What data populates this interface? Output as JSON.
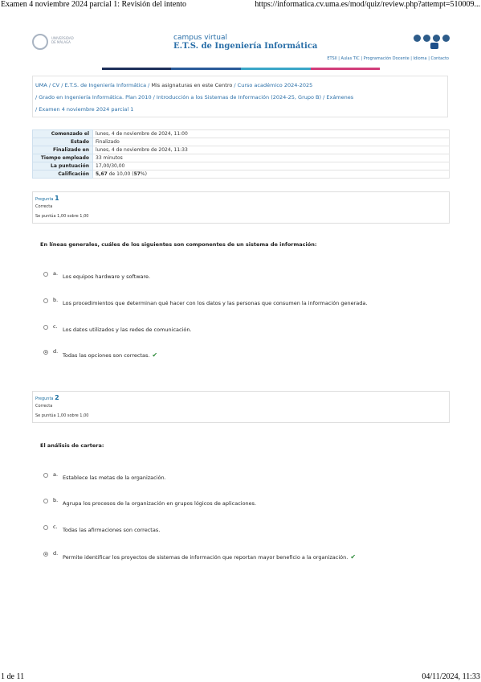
{
  "print_header": {
    "left": "Examen 4 noviembre 2024 parcial 1: Revisión del intento",
    "right": "https://informatica.cv.uma.es/mod/quiz/review.php?attempt=510009..."
  },
  "print_footer": {
    "left": "1 de 11",
    "right": "04/11/2024, 11:33"
  },
  "site": {
    "logo_text_1": "UNIVERSIDAD",
    "logo_text_2": "DE MÁLAGA",
    "cv_label": "campus virtual",
    "title": "E.T.S. de Ingeniería Informática",
    "top_links": "ETSII | Aulas TIC | Programación Docente | Idioma | Contacto",
    "colors": [
      "#ffffff",
      "#1d2f5a",
      "#2a5b9a",
      "#3aa6c8",
      "#d23d7a",
      "#ffffff"
    ]
  },
  "breadcrumb": {
    "items": [
      "UMA",
      "CV",
      "E.T.S. de Ingeniería Informática",
      "Mis asignaturas en este Centro",
      "Curso académico 2024-2025",
      "Grado en Ingeniería Informática. Plan 2010",
      "Introducción a los Sistemas de Información (2024-25, Grupo B)",
      "Exámenes",
      "Examen 4 noviembre 2024 parcial 1"
    ]
  },
  "summary": [
    {
      "label": "Comenzado el",
      "value": "lunes, 4 de noviembre de 2024, 11:00"
    },
    {
      "label": "Estado",
      "value": "Finalizado"
    },
    {
      "label": "Finalizado en",
      "value": "lunes, 4 de noviembre de 2024, 11:33"
    },
    {
      "label": "Tiempo empleado",
      "value": "33 minutos"
    },
    {
      "label": "La puntuación",
      "value": "17,00/30,00"
    },
    {
      "label": "Calificación",
      "value_bold_1": "5,67",
      "value_mid": " de 10,00 (",
      "value_bold_2": "57",
      "value_end": "%)"
    }
  ],
  "questions": [
    {
      "prefix": "Pregunta",
      "number": "1",
      "state": "Correcta",
      "grade": "Se puntúa 1,00 sobre 1,00",
      "text": "En líneas generales, cuáles de los siguientes son componentes de un sistema de información:",
      "options": [
        {
          "letter": "a.",
          "text": "Los equipos hardware y software."
        },
        {
          "letter": "b.",
          "text": "Los procedimientos que determinan qué hacer con los datos y las personas que consumen la información generada."
        },
        {
          "letter": "c.",
          "text": "Los datos utilizados y las redes de comunicación."
        },
        {
          "letter": "d.",
          "text": "Todas las opciones son correctas."
        }
      ]
    },
    {
      "prefix": "Pregunta",
      "number": "2",
      "state": "Correcta",
      "grade": "Se puntúa 1,00 sobre 1,00",
      "text": "El análisis de cartera:",
      "options": [
        {
          "letter": "a.",
          "text": "Establece las metas de la organización."
        },
        {
          "letter": "b.",
          "text": "Agrupa los procesos de la organización en grupos lógicos de aplicaciones."
        },
        {
          "letter": "c.",
          "text": "Todas las afirmaciones son correctas."
        },
        {
          "letter": "d.",
          "text": "Permite identificar los proyectos de sistemas de información que reportan mayor beneficio a la organización."
        }
      ]
    }
  ],
  "icons": [
    "bell-icon",
    "chat-icon",
    "mail-icon",
    "help-icon",
    "check-icon"
  ]
}
